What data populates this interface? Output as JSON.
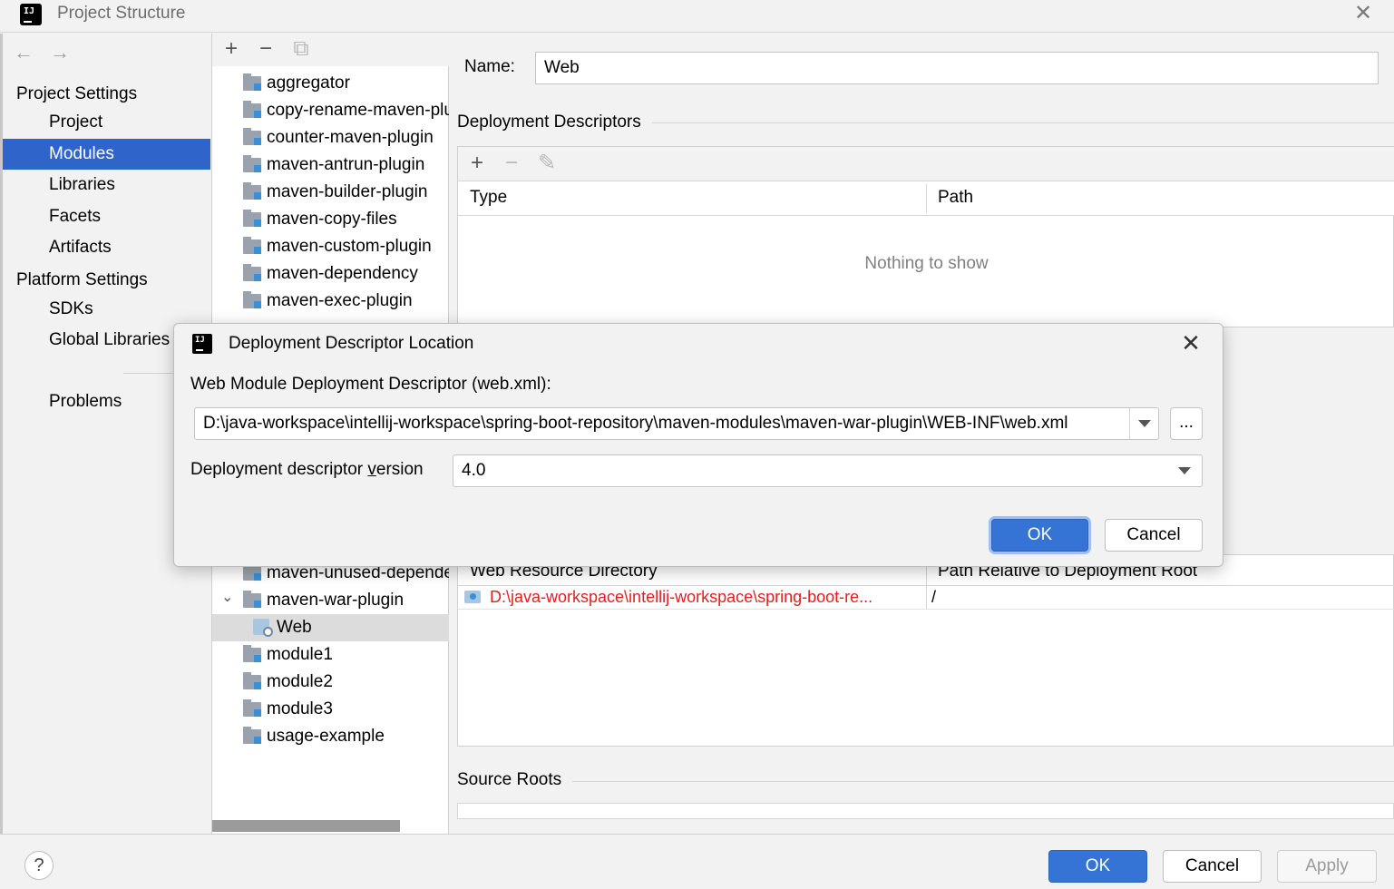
{
  "window": {
    "title": "Project Structure",
    "close_glyph": "✕"
  },
  "nav": {
    "back_glyph": "←",
    "forward_glyph": "→",
    "project_settings_heading": "Project Settings",
    "platform_settings_heading": "Platform Settings",
    "items": {
      "project": "Project",
      "modules": "Modules",
      "libraries": "Libraries",
      "facets": "Facets",
      "artifacts": "Artifacts",
      "sdks": "SDKs",
      "global_libraries": "Global Libraries",
      "problems": "Problems"
    },
    "selected": "Modules"
  },
  "tree": {
    "toolbar": {
      "add": "+",
      "remove": "−",
      "copy": "⧉"
    },
    "rows_top": [
      "aggregator",
      "copy-rename-maven-plugin",
      "counter-maven-plugin",
      "maven-antrun-plugin",
      "maven-builder-plugin",
      "maven-copy-files",
      "maven-custom-plugin",
      "maven-dependency",
      "maven-exec-plugin"
    ],
    "rows_bottom": {
      "unused": "maven-unused-dependencies",
      "war": "maven-war-plugin",
      "web": "Web",
      "module1": "module1",
      "module2": "module2",
      "module3": "module3",
      "usage": "usage-example"
    },
    "expanded_chevron": "⌄",
    "selected": "Web"
  },
  "content": {
    "name_label": "Name:",
    "name_value": "Web",
    "deployment_descriptors_title": "Deployment Descriptors",
    "dd_toolbar": {
      "add": "+",
      "remove": "−",
      "edit": "✎"
    },
    "dd_columns": {
      "type": "Type",
      "path": "Path"
    },
    "empty_text": "Nothing to show",
    "web_resource": {
      "col_dir": "Web Resource Directory",
      "col_rel": "Path Relative to Deployment Root",
      "row_path": "D:\\java-workspace\\intellij-workspace\\spring-boot-re...",
      "row_rel": "/"
    },
    "source_roots_title": "Source Roots"
  },
  "footer": {
    "help": "?",
    "ok": "OK",
    "cancel": "Cancel",
    "apply": "Apply"
  },
  "dialog": {
    "title": "Deployment Descriptor Location",
    "close_glyph": "✕",
    "descriptor_label": "Web Module Deployment Descriptor (web.xml):",
    "descriptor_path": "D:\\java-workspace\\intellij-workspace\\spring-boot-repository\\maven-modules\\maven-war-plugin\\WEB-INF\\web.xml",
    "browse": "...",
    "version_label_pre": "Deployment descriptor ",
    "version_label_mnemonic": "v",
    "version_label_post": "ersion",
    "version_value": "4.0",
    "ok": "OK",
    "cancel": "Cancel"
  },
  "colors": {
    "selection": "#2f65ca",
    "primary_button": "#3574d5",
    "error_path": "#e61d1d"
  }
}
